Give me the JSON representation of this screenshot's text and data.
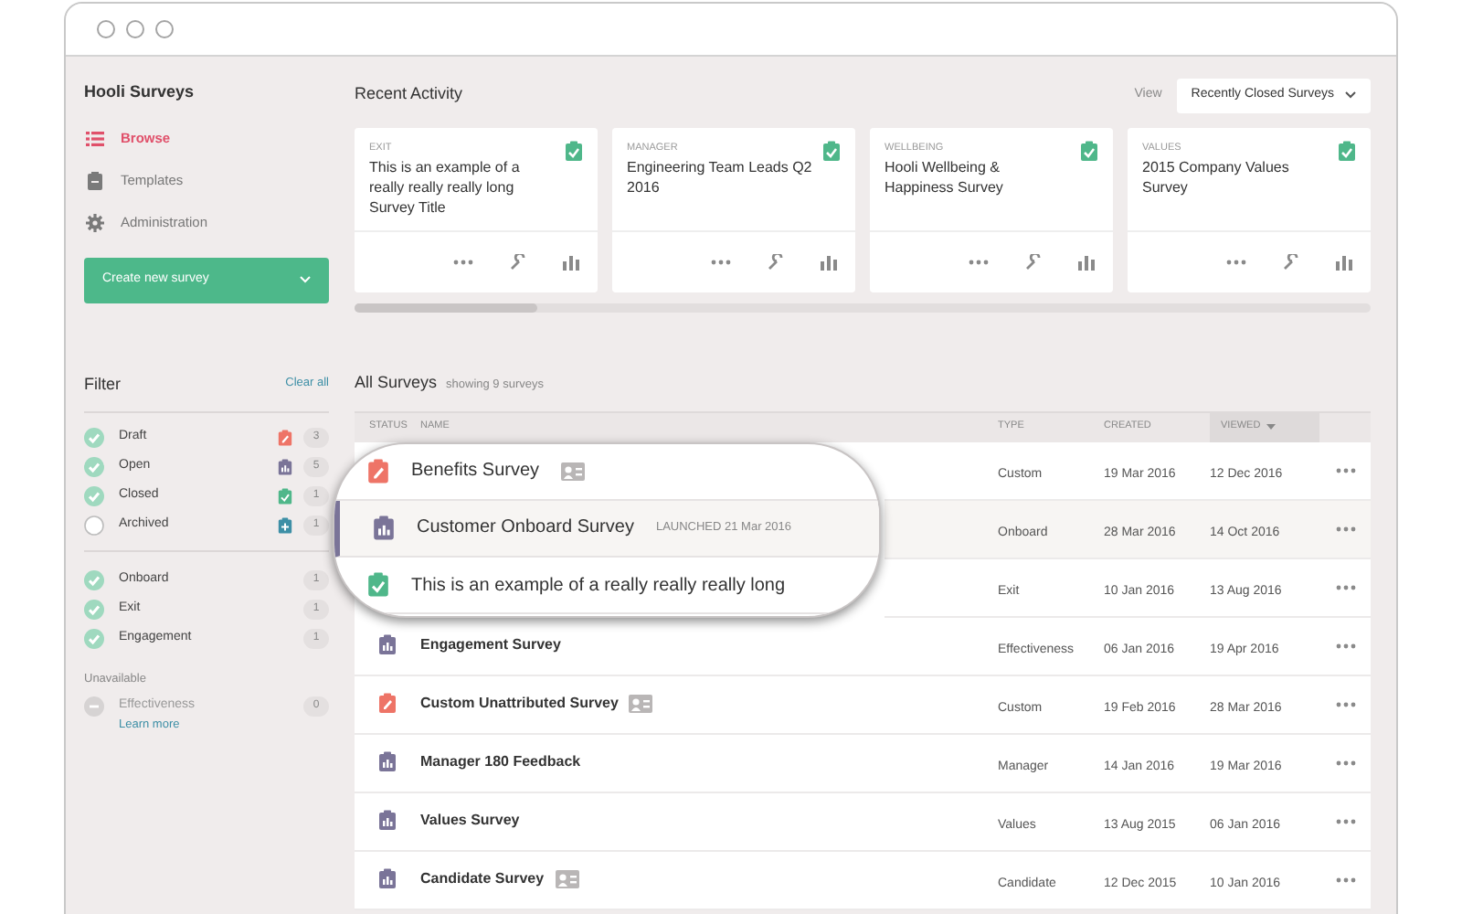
{
  "sidebar": {
    "title": "Hooli Surveys",
    "nav": [
      {
        "label": "Browse",
        "kind": "list",
        "selected": true
      },
      {
        "label": "Templates",
        "kind": "clipboard",
        "selected": false
      },
      {
        "label": "Administration",
        "kind": "gear",
        "selected": false
      }
    ],
    "create_button": "Create new survey",
    "filter": {
      "title": "Filter",
      "clear": "Clear all",
      "statuses": [
        {
          "label": "Draft",
          "checked": true,
          "kind": "draft",
          "count": "3"
        },
        {
          "label": "Open",
          "checked": true,
          "kind": "open",
          "count": "5"
        },
        {
          "label": "Closed",
          "checked": true,
          "kind": "closed",
          "count": "1"
        },
        {
          "label": "Archived",
          "checked": false,
          "kind": "archived",
          "count": "1"
        }
      ],
      "types": [
        {
          "label": "Onboard",
          "checked": true,
          "count": "1"
        },
        {
          "label": "Exit",
          "checked": true,
          "count": "1"
        },
        {
          "label": "Engagement",
          "checked": true,
          "count": "1"
        }
      ],
      "unavailable_title": "Unavailable",
      "unavailable": [
        {
          "label": "Effectiveness",
          "count": "0",
          "link": "Learn more"
        }
      ]
    }
  },
  "recent": {
    "title": "Recent Activity",
    "view_label": "View",
    "view_value": "Recently Closed Surveys",
    "cards": [
      {
        "category": "EXIT",
        "title": "This is an example of a really really really long Survey Title",
        "kind": "closed"
      },
      {
        "category": "MANAGER",
        "title": "Engineering Team Leads Q2 2016",
        "kind": "closed"
      },
      {
        "category": "WELLBEING",
        "title": "Hooli Wellbeing & Happiness Survey",
        "kind": "closed"
      },
      {
        "category": "VALUES",
        "title": "2015 Company Values Survey",
        "kind": "closed"
      }
    ]
  },
  "all": {
    "title": "All Surveys",
    "subtitle": "showing 9 surveys",
    "columns": [
      {
        "label": "STATUS",
        "sorted": false
      },
      {
        "label": "NAME",
        "sorted": false
      },
      {
        "label": "TYPE",
        "sorted": false
      },
      {
        "label": "CREATED",
        "sorted": false
      },
      {
        "label": "VIEWED",
        "sorted": true
      }
    ],
    "rows": [
      {
        "kind": "draft",
        "name": "Benefits Survey",
        "badge_icon": true,
        "magnified": true,
        "selected": false,
        "type": "Custom",
        "created": "19 Mar 2016",
        "viewed": "12 Dec 2016"
      },
      {
        "kind": "open",
        "name": "Customer Onboard Survey",
        "note": "LAUNCHED 21 Mar 2016",
        "badge_icon": false,
        "magnified": true,
        "selected": true,
        "type": "Onboard",
        "created": "28 Mar 2016",
        "viewed": "14 Oct 2016"
      },
      {
        "kind": "closed",
        "name": "This is an example of a really really really long",
        "badge_icon": false,
        "magnified": true,
        "selected": false,
        "type": "Exit",
        "created": "10 Jan 2016",
        "viewed": "13 Aug 2016"
      },
      {
        "kind": "open",
        "name": "Engagement Survey",
        "badge_icon": false,
        "magnified": false,
        "selected": false,
        "type": "Effectiveness",
        "created": "06 Jan 2016",
        "viewed": "19 Apr 2016"
      },
      {
        "kind": "draft",
        "name": "Custom Unattributed Survey",
        "badge_icon": true,
        "magnified": false,
        "selected": false,
        "type": "Custom",
        "created": "19 Feb 2016",
        "viewed": "28 Mar 2016"
      },
      {
        "kind": "open",
        "name": "Manager 180 Feedback",
        "badge_icon": false,
        "magnified": false,
        "selected": false,
        "type": "Manager",
        "created": "14 Jan 2016",
        "viewed": "19 Mar 2016"
      },
      {
        "kind": "open",
        "name": "Values Survey",
        "badge_icon": false,
        "magnified": false,
        "selected": false,
        "type": "Values",
        "created": "13 Aug 2015",
        "viewed": "06 Jan 2016"
      },
      {
        "kind": "open",
        "name": "Candidate Survey",
        "badge_icon": true,
        "magnified": false,
        "selected": false,
        "type": "Candidate",
        "created": "12 Dec 2015",
        "viewed": "10 Jan 2016"
      }
    ]
  }
}
